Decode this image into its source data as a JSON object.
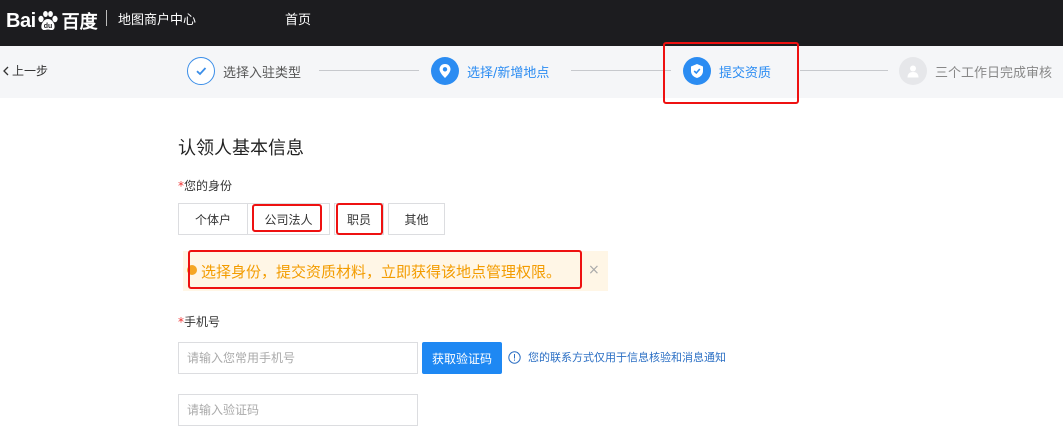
{
  "topbar": {
    "logo_latin": "Bai",
    "logo_du": "du",
    "logo_cn": "百度",
    "product": "地图商户中心",
    "home": "首页"
  },
  "steps": {
    "back": "上一步",
    "items": [
      {
        "label": "选择入驻类型",
        "state": "done"
      },
      {
        "label": "选择/新增地点",
        "state": "active"
      },
      {
        "label": "提交资质",
        "state": "active"
      },
      {
        "label": "三个工作日完成审核",
        "state": "todo"
      }
    ]
  },
  "form": {
    "title": "认领人基本信息",
    "identity_label": "您的身份",
    "required_mark": "*",
    "identity_options": [
      "个体户",
      "公司法人",
      "职员",
      "其他"
    ],
    "notice": "选择身份，提交资质材料，立即获得该地点管理权限。",
    "close": "×",
    "phone_label": "手机号",
    "phone_placeholder": "请输入您常用手机号",
    "get_code": "获取验证码",
    "hint": "您的联系方式仅用于信息核验和消息通知",
    "code_placeholder": "请输入验证码"
  },
  "colors": {
    "accent": "#2b8cf2",
    "topbar": "#1c1c1f",
    "notice_text": "#f39c00",
    "highlight": "#ee1111"
  }
}
